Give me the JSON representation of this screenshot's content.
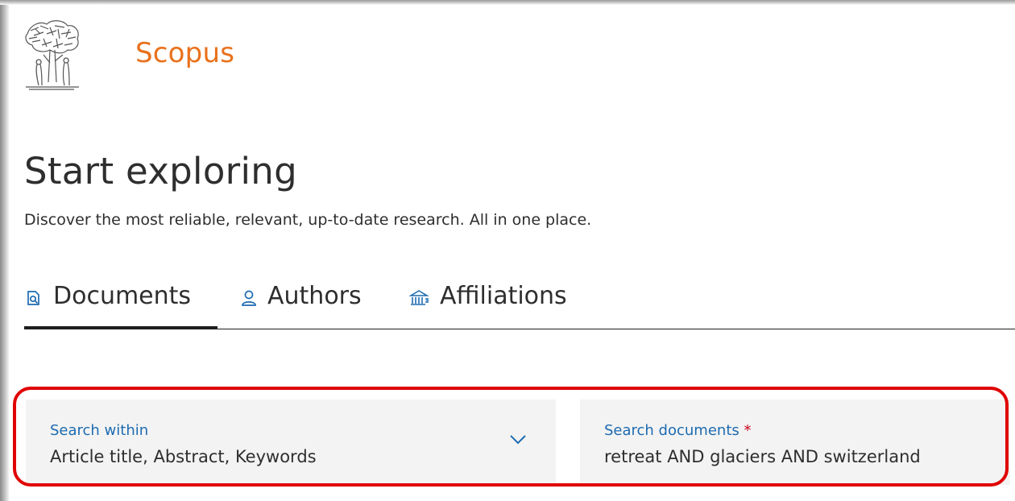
{
  "header": {
    "brand": "Scopus",
    "logo_icon": "elsevier-tree-logo-icon",
    "brand_color": "#e9711c"
  },
  "hero": {
    "title": "Start exploring",
    "subtitle": "Discover the most reliable, relevant, up-to-date research. All in one place."
  },
  "tabs": [
    {
      "label": "Documents",
      "icon": "document-search-icon",
      "active": true
    },
    {
      "label": "Authors",
      "icon": "person-icon",
      "active": false
    },
    {
      "label": "Affiliations",
      "icon": "institution-icon",
      "active": false
    }
  ],
  "search": {
    "within": {
      "label": "Search within",
      "value": "Article title, Abstract, Keywords",
      "icon": "chevron-down-icon"
    },
    "documents": {
      "label": "Search documents",
      "required_marker": "*",
      "value": "retreat AND glaciers AND switzerland"
    },
    "highlight_color": "#e00000"
  },
  "colors": {
    "accent": "#1d6bb0",
    "text": "#2e2e2e",
    "field_bg": "#f3f3f3"
  }
}
